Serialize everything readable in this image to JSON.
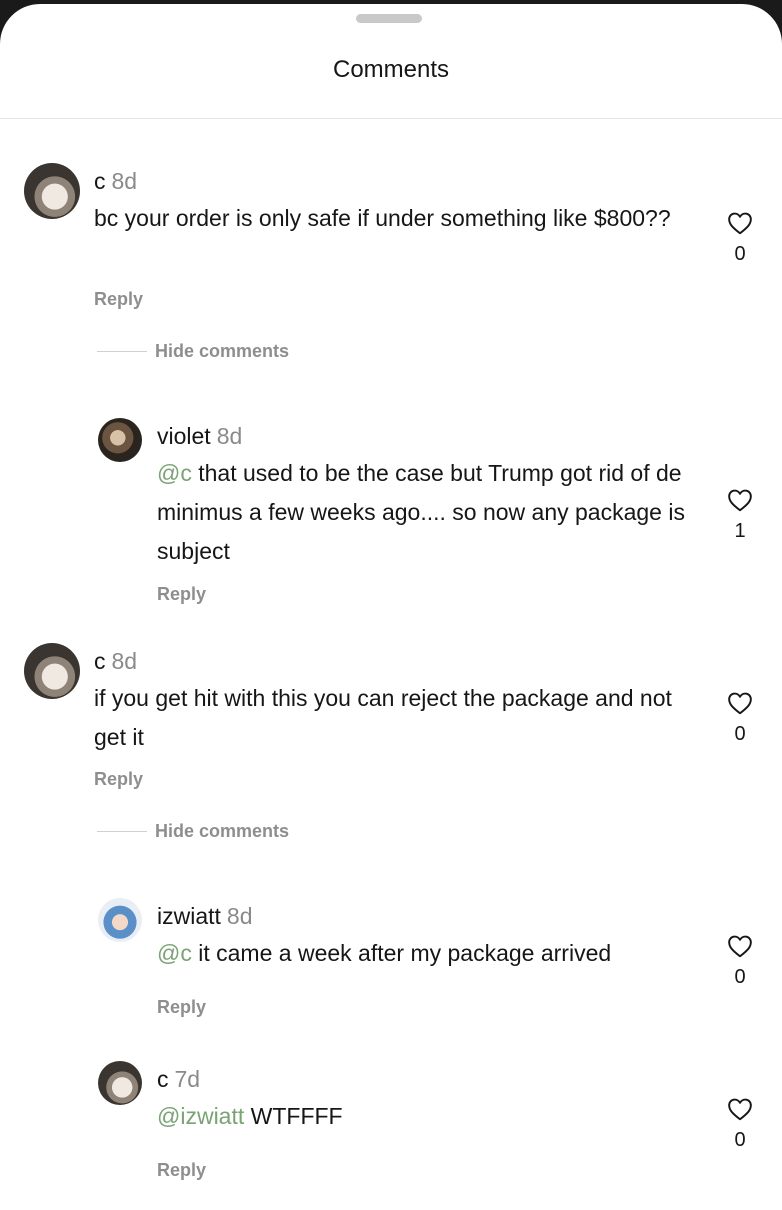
{
  "header": {
    "title": "Comments"
  },
  "comments": [
    {
      "username": "c",
      "age": "8d",
      "body": "bc your order is only safe if under something like $800??",
      "reply_label": "Reply",
      "likes": "0",
      "hide_label": "Hide comments"
    },
    {
      "username": "violet",
      "age": "8d",
      "mention": "@c",
      "body": " that used to be the case but Trump got rid of de minimus a few weeks ago.... so now any package is subject",
      "reply_label": "Reply",
      "likes": "1"
    },
    {
      "username": "c",
      "age": "8d",
      "body": "if you get hit with this you can reject the package and not get it",
      "reply_label": "Reply",
      "likes": "0",
      "hide_label": "Hide comments"
    },
    {
      "username": "izwiatt",
      "age": "8d",
      "mention": "@c",
      "body": " it came a week after my package arrived",
      "reply_label": "Reply",
      "likes": "0"
    },
    {
      "username": "c",
      "age": "7d",
      "mention": "@izwiatt",
      "body": " WTFFFF",
      "reply_label": "Reply",
      "likes": "0"
    }
  ],
  "icons": {
    "like": "heart-outline-icon"
  },
  "colors": {
    "mention": "#7aa374",
    "secondary_text": "#8e8e8e"
  }
}
